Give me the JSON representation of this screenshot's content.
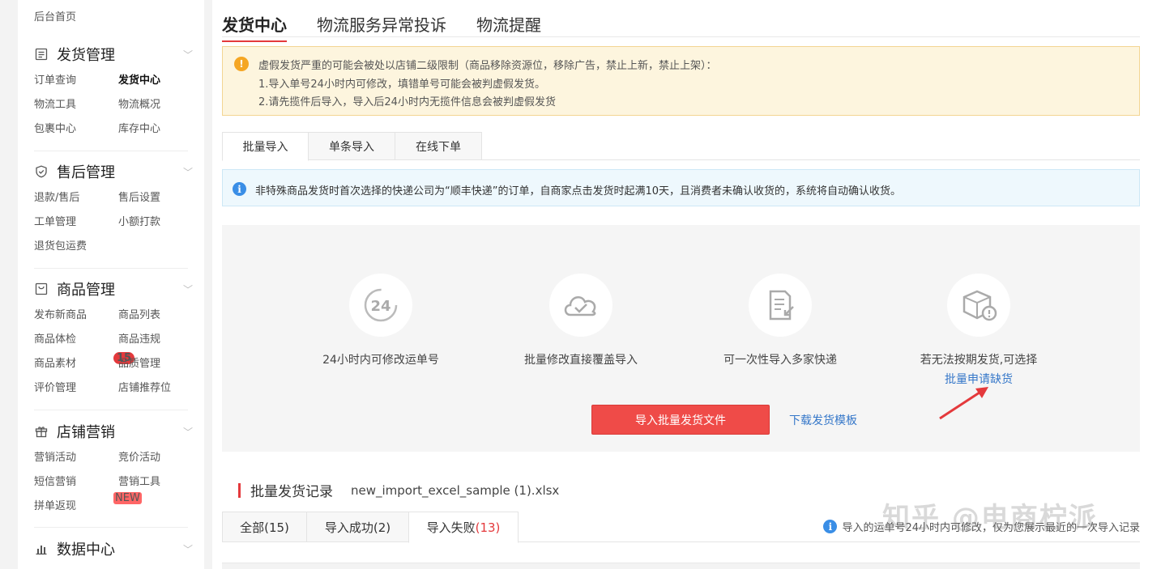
{
  "sidebar": {
    "home": "后台首页",
    "sections": [
      {
        "title": "发货管理",
        "items": [
          "订单查询",
          "发货中心",
          "物流工具",
          "物流概况",
          "包裹中心",
          "库存中心"
        ]
      },
      {
        "title": "售后管理",
        "items": [
          "退款/售后",
          "售后设置",
          "工单管理",
          "小额打款",
          "退货包运费"
        ]
      },
      {
        "title": "商品管理",
        "items": [
          "发布新商品",
          "商品列表",
          "商品体检",
          "商品违规",
          "商品素材",
          "品质管理",
          "评价管理",
          "店铺推荐位"
        ]
      },
      {
        "title": "店铺营销",
        "items": [
          "营销活动",
          "竞价活动",
          "短信营销",
          "营销工具",
          "拼单返现"
        ]
      },
      {
        "title": "数据中心"
      }
    ],
    "badge_count": "15",
    "new_tag": "NEW"
  },
  "top_tabs": [
    "发货中心",
    "物流服务异常投诉",
    "物流提醒"
  ],
  "warning": {
    "line1": "虚假发货严重的可能会被处以店铺二级限制（商品移除资源位，移除广告，禁止上新，禁止上架）：",
    "line2": "1.导入单号24小时内可修改，填错单号可能会被判虚假发货。",
    "line3": "2.请先揽件后导入，导入后24小时内无揽件信息会被判虚假发货"
  },
  "sub_tabs": [
    "批量导入",
    "单条导入",
    "在线下单"
  ],
  "info": "非特殊商品发货时首次选择的快递公司为“顺丰快递”的订单，自商家点击发货时起满10天，且消费者未确认收货的，系统将自动确认收货。",
  "features": [
    {
      "icon": "clock-24-icon",
      "glyph": "24",
      "label": "24小时内可修改运单号"
    },
    {
      "icon": "cloud-check-icon",
      "label": "批量修改直接覆盖导入"
    },
    {
      "icon": "document-import-icon",
      "label": "可一次性导入多家快递"
    },
    {
      "icon": "package-alert-icon",
      "label": "若无法按期发货,可选择",
      "link": "批量申请缺货"
    }
  ],
  "import_button": "导入批量发货文件",
  "template_link": "下载发货模板",
  "record": {
    "title": "批量发货记录",
    "file": "new_import_excel_sample (1).xlsx"
  },
  "result_tabs": [
    {
      "label": "全部(15)"
    },
    {
      "label": "导入成功(2)"
    },
    {
      "label": "导入失败",
      "count": "(13)"
    }
  ],
  "hint": "导入的运单号24小时内可修改，仅为您展示最近的一次导入记录",
  "watermark": "知乎 @电商柠派",
  "colors": {
    "accent": "#e4393c",
    "link": "#3577c9",
    "warning_bg": "#fdf5de",
    "info_bg": "#eef8fd"
  }
}
